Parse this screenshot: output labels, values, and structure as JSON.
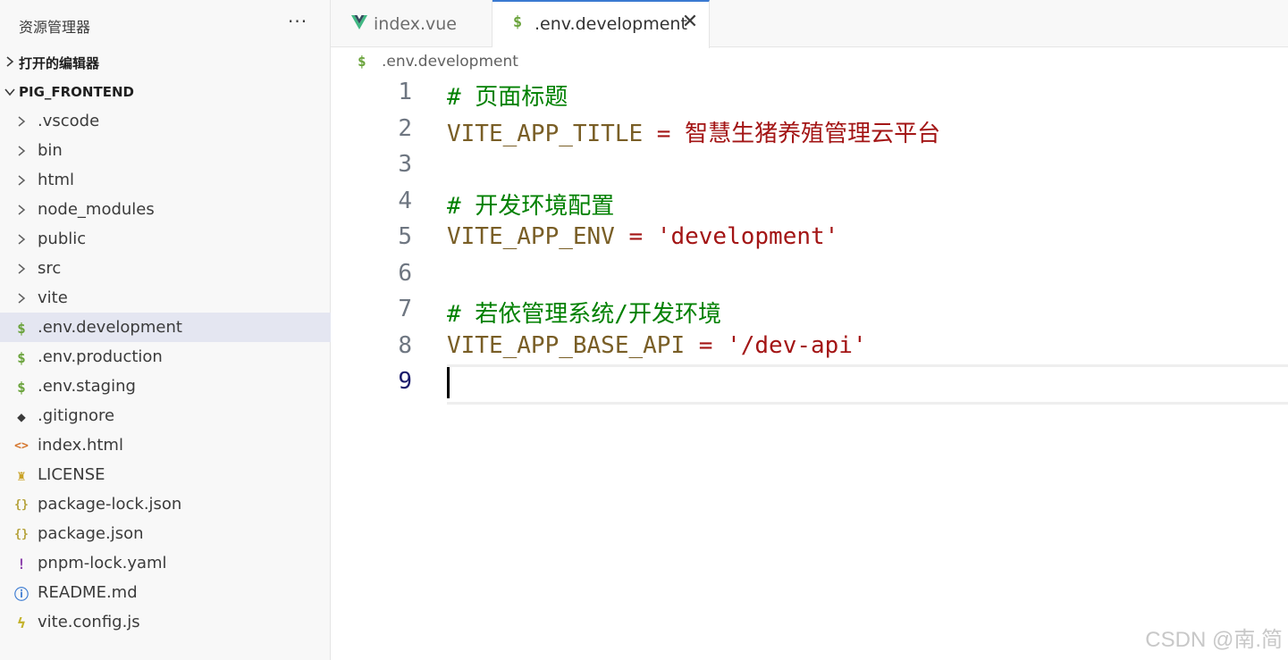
{
  "sidebar": {
    "title": "资源管理器",
    "more": "···",
    "open_editors_label": "打开的编辑器",
    "project_label": "PIG_FRONTEND",
    "items": [
      {
        "label": ".vscode",
        "icon": "chevron-right-icon",
        "glyph": "›",
        "color": "#616161"
      },
      {
        "label": "bin",
        "icon": "chevron-right-icon",
        "glyph": "›",
        "color": "#616161"
      },
      {
        "label": "html",
        "icon": "chevron-right-icon",
        "glyph": "›",
        "color": "#616161"
      },
      {
        "label": "node_modules",
        "icon": "chevron-right-icon",
        "glyph": "›",
        "color": "#616161"
      },
      {
        "label": "public",
        "icon": "chevron-right-icon",
        "glyph": "›",
        "color": "#616161"
      },
      {
        "label": "src",
        "icon": "chevron-right-icon",
        "glyph": "›",
        "color": "#616161"
      },
      {
        "label": "vite",
        "icon": "chevron-right-icon",
        "glyph": "›",
        "color": "#616161"
      },
      {
        "label": ".env.development",
        "icon": "dollar-icon",
        "glyph": "$",
        "color": "#6aa33b",
        "selected": true
      },
      {
        "label": ".env.production",
        "icon": "dollar-icon",
        "glyph": "$",
        "color": "#6aa33b"
      },
      {
        "label": ".env.staging",
        "icon": "dollar-icon",
        "glyph": "$",
        "color": "#6aa33b"
      },
      {
        "label": ".gitignore",
        "icon": "git-icon",
        "glyph": "◆",
        "color": "#3b3b3b"
      },
      {
        "label": "index.html",
        "icon": "html-icon",
        "glyph": "<>",
        "color": "#d5772f"
      },
      {
        "label": "LICENSE",
        "icon": "license-icon",
        "glyph": "♜",
        "color": "#c9a227"
      },
      {
        "label": "package-lock.json",
        "icon": "json-icon",
        "glyph": "{}",
        "color": "#b5a23b"
      },
      {
        "label": "package.json",
        "icon": "json-icon",
        "glyph": "{}",
        "color": "#b5a23b"
      },
      {
        "label": "pnpm-lock.yaml",
        "icon": "yaml-icon",
        "glyph": "!",
        "color": "#8e44ad"
      },
      {
        "label": "README.md",
        "icon": "info-icon",
        "glyph": "ⓘ",
        "color": "#3a7ad1"
      },
      {
        "label": "vite.config.js",
        "icon": "vite-icon",
        "glyph": "ϟ",
        "color": "#c4b32e"
      }
    ]
  },
  "tabs": [
    {
      "label": "index.vue",
      "icon": "vue-icon",
      "glyph": "V",
      "color": "#41b883",
      "active": false
    },
    {
      "label": ".env.development",
      "icon": "dollar-icon",
      "glyph": "$",
      "color": "#6aa33b",
      "active": true,
      "close": "✕"
    }
  ],
  "breadcrumb": {
    "icon": "$",
    "label": ".env.development"
  },
  "editor": {
    "lines": [
      {
        "n": "1",
        "tokens": [
          {
            "t": "# 页面标题",
            "c": "comment"
          }
        ]
      },
      {
        "n": "2",
        "tokens": [
          {
            "t": "VITE_APP_TITLE",
            "c": "key"
          },
          {
            "t": " = ",
            "c": "op"
          },
          {
            "t": "智慧生猪养殖管理云平台",
            "c": "str"
          }
        ]
      },
      {
        "n": "3",
        "tokens": []
      },
      {
        "n": "4",
        "tokens": [
          {
            "t": "# 开发环境配置",
            "c": "comment"
          }
        ]
      },
      {
        "n": "5",
        "tokens": [
          {
            "t": "VITE_APP_ENV",
            "c": "key"
          },
          {
            "t": " = ",
            "c": "op"
          },
          {
            "t": "'development'",
            "c": "str"
          }
        ]
      },
      {
        "n": "6",
        "tokens": []
      },
      {
        "n": "7",
        "tokens": [
          {
            "t": "# 若依管理系统/开发环境",
            "c": "comment"
          }
        ]
      },
      {
        "n": "8",
        "tokens": [
          {
            "t": "VITE_APP_BASE_API",
            "c": "key"
          },
          {
            "t": " = ",
            "c": "op"
          },
          {
            "t": "'/dev-api'",
            "c": "str"
          }
        ]
      },
      {
        "n": "9",
        "tokens": [],
        "current": true
      }
    ]
  },
  "watermark": "CSDN @南.简"
}
